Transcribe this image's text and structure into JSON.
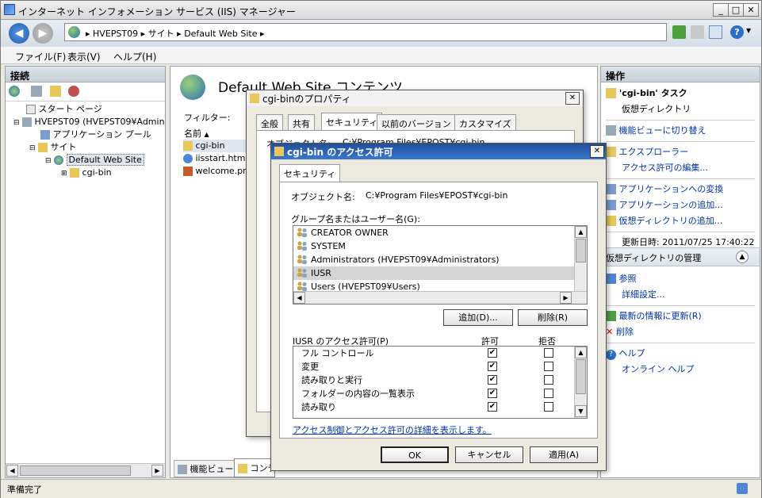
{
  "window": {
    "title": "インターネット インフォメーション サービス (IIS) マネージャー"
  },
  "address": {
    "crumbs": [
      "HVEPST09",
      "サイト",
      "Default Web Site"
    ]
  },
  "menu": [
    "ファイル(F)",
    "表示(V)",
    "ヘルプ(H)"
  ],
  "left_panel": {
    "header": "接続",
    "tree": [
      {
        "label": "スタート ページ",
        "indent": 0
      },
      {
        "label": "HVEPST09 (HVEPST09¥Admin",
        "indent": 0
      },
      {
        "label": "アプリケーション プール",
        "indent": 1
      },
      {
        "label": "サイト",
        "indent": 1
      },
      {
        "label": "Default Web Site",
        "indent": 2
      },
      {
        "label": "cgi-bin",
        "indent": 3
      }
    ]
  },
  "center": {
    "title": "Default Web Site コンテンツ",
    "filter_label": "フィルター:",
    "col_name": "名前",
    "files": [
      "cgi-bin",
      "iisstart.htm",
      "welcome.png"
    ],
    "bottom_tabs": [
      "機能ビュー",
      "コンテンツ ビュー"
    ]
  },
  "right_panel": {
    "header": "操作",
    "task_title": "'cgi-bin' タスク",
    "task_sub": "仮想ディレクトリ",
    "actions": [
      "機能ビューに切り替え",
      "エクスプローラー",
      "アクセス許可の編集...",
      "アプリケーションへの変換",
      "アプリケーションの追加...",
      "仮想ディレクトリの追加..."
    ],
    "updated": "更新日時: 2011/07/25 17:40:22",
    "section2": "仮想ディレクトリの管理",
    "section2_actions": [
      "参照",
      "詳細設定..."
    ],
    "refresh": "最新の情報に更新(R)",
    "remove": "削除",
    "help": "ヘルプ",
    "online_help": "オンライン ヘルプ"
  },
  "prop_dialog": {
    "title": "cgi-binのプロパティ",
    "tabs": [
      "全般",
      "共有",
      "セキュリティ",
      "以前のバージョン",
      "カスタマイズ"
    ],
    "object_label": "オブジェクト名:",
    "object_value": "C:¥Program Files¥EPOST¥cgi-bin"
  },
  "perm_dialog": {
    "title": "cgi-bin のアクセス許可",
    "tab": "セキュリティ",
    "object_label": "オブジェクト名:",
    "object_value": "C:¥Program Files¥EPOST¥cgi-bin",
    "group_label": "グループ名またはユーザー名(G):",
    "users": [
      "CREATOR OWNER",
      "SYSTEM",
      "Administrators (HVEPST09¥Administrators)",
      "IUSR",
      "Users (HVEPST09¥Users)"
    ],
    "selected_user_index": 3,
    "add_button": "追加(D)...",
    "remove_button": "削除(R)",
    "perm_label": "IUSR のアクセス許可(P)",
    "allow_header": "許可",
    "deny_header": "拒否",
    "permissions": [
      {
        "name": "フル コントロール",
        "allow": true,
        "deny": false
      },
      {
        "name": "変更",
        "allow": true,
        "deny": false
      },
      {
        "name": "読み取りと実行",
        "allow": true,
        "deny": false
      },
      {
        "name": "フォルダーの内容の一覧表示",
        "allow": true,
        "deny": false
      },
      {
        "name": "読み取り",
        "allow": true,
        "deny": false
      }
    ],
    "link": "アクセス制御とアクセス許可の詳細を表示します。",
    "ok": "OK",
    "cancel": "キャンセル",
    "apply": "適用(A)"
  },
  "status": {
    "text": "準備完了"
  },
  "colors": {
    "accent": "#2a6fc9",
    "link": "#0033aa",
    "selected": "#d4d4d4"
  }
}
